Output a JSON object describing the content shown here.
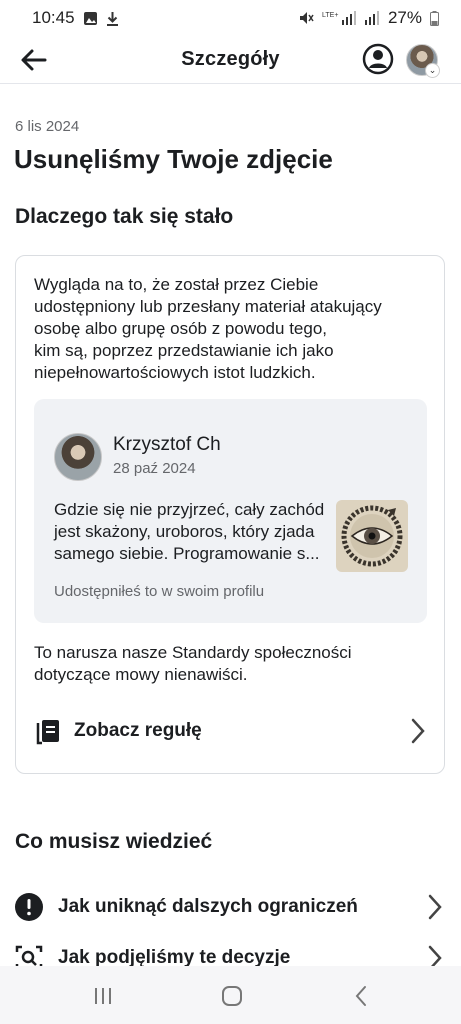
{
  "status_bar": {
    "time": "10:45",
    "battery": "27%"
  },
  "header": {
    "title": "Szczegóły"
  },
  "notice": {
    "date": "6 lis 2024",
    "title": "Usunęliśmy Twoje zdjęcie",
    "why_heading": "Dlaczego tak się stało",
    "explanation": [
      "Wygląda na to, że został przez Ciebie",
      "udostępniony lub przesłany materiał atakujący",
      "osobę albo grupę osób z powodu tego,",
      "kim są, poprzez przedstawianie ich jako",
      "niepełnowartościowych istot ludzkich."
    ]
  },
  "post": {
    "author": "Krzysztof Ch",
    "date": "28 paź 2024",
    "text": [
      "Gdzie się nie przyjrzeć, cały zachód",
      "jest skażony, uroboros, który zjada",
      "samego siebie. Programowanie s..."
    ],
    "footer": "Udostępniłeś to w swoim profilu"
  },
  "violation": [
    "To narusza nasze Standardy społeczności",
    "dotyczące mowy nienawiści."
  ],
  "rule_link": {
    "label": "Zobacz regułę"
  },
  "know_section": {
    "heading": "Co musisz wiedzieć",
    "items": [
      {
        "label": "Jak uniknąć dalszych ograniczeń",
        "icon": "exclamation-icon"
      },
      {
        "label": "Jak podjęliśmy te decyzje",
        "icon": "magnifier-icon"
      }
    ]
  }
}
